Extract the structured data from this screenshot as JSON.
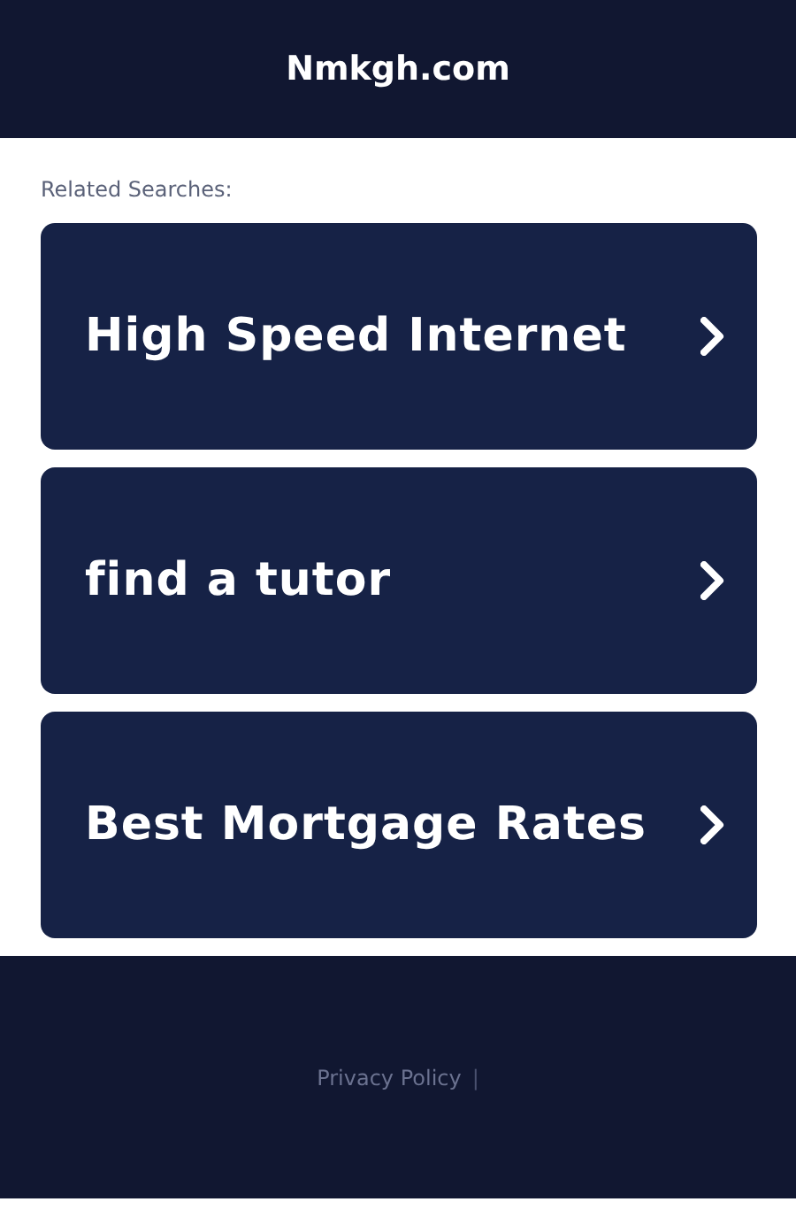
{
  "header": {
    "title": "Nmkgh.com"
  },
  "related_label": "Related Searches:",
  "searches": [
    {
      "label": "High Speed Internet"
    },
    {
      "label": "find a tutor"
    },
    {
      "label": "Best Mortgage Rates"
    }
  ],
  "footer": {
    "links": [
      "Privacy Policy"
    ],
    "separator": "|"
  }
}
